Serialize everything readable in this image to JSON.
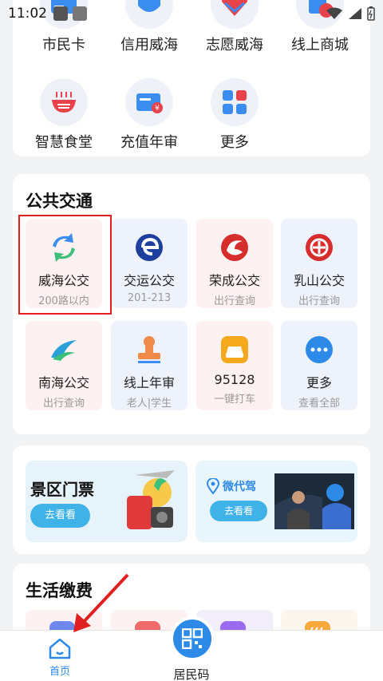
{
  "status": {
    "time": "11:02"
  },
  "top_services": [
    {
      "label": "市民卡",
      "icon": "citizen-card-icon"
    },
    {
      "label": "信用威海",
      "icon": "credit-icon"
    },
    {
      "label": "志愿威海",
      "icon": "volunteer-icon"
    },
    {
      "label": "线上商城",
      "icon": "mall-icon"
    },
    {
      "label": "智慧食堂",
      "icon": "canteen-icon"
    },
    {
      "label": "充值年审",
      "icon": "recharge-icon"
    },
    {
      "label": "更多",
      "icon": "more-grid-icon"
    }
  ],
  "transit": {
    "title": "公共交通",
    "items": [
      {
        "name": "威海公交",
        "sub": "200路以内"
      },
      {
        "name": "交运公交",
        "sub": "201-213"
      },
      {
        "name": "荣成公交",
        "sub": "出行查询"
      },
      {
        "name": "乳山公交",
        "sub": "出行查询"
      },
      {
        "name": "南海公交",
        "sub": "出行查询"
      },
      {
        "name": "线上年审",
        "sub": "老人|学生"
      },
      {
        "name": "95128",
        "sub": "一键打车"
      },
      {
        "name": "更多",
        "sub": "查看全部"
      }
    ]
  },
  "banners": {
    "left": {
      "title": "景区门票",
      "button": "去看看"
    },
    "right": {
      "logo": "微代驾",
      "button": "去看看"
    }
  },
  "life": {
    "title": "生活缴费"
  },
  "nav": {
    "home": "首页",
    "qr": "居民码"
  },
  "colors": {
    "accent": "#2d8ae6",
    "highlight": "#e02020"
  }
}
